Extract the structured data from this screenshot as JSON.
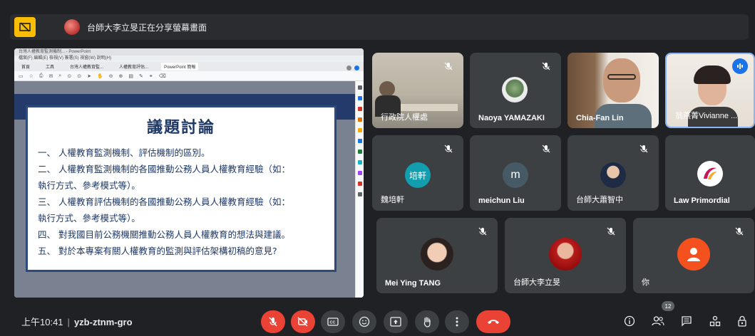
{
  "presenting": {
    "text": "台師大李立旻正在分享螢幕畫面"
  },
  "shared_screen": {
    "app_title": "台灣人權教育監測機制... - PowerPoint",
    "menu": "檔案(F)  編輯(E)  檢視(V)  簽署(S)  視窗(W)  說明(H)",
    "tabs": [
      "首頁",
      "工具",
      "台灣人權教育監...",
      "人權教育評估...",
      "PowerPoint 簡報"
    ],
    "slide": {
      "title": "議題討論",
      "items": [
        "一、 人權教育監測機制、評估機制的區別。",
        "二、 人權教育監測機制的各國推動公務人員人權教育經驗（如：",
        "執行方式、參考模式等）。",
        "三、 人權教育評估機制的各國推動公務人員人權教育經驗（如：",
        "執行方式、參考模式等）。",
        "四、 對我國目前公務機關推動公務人員人權教育的想法與建議。",
        "五、 對於本專案有關人權教育的監測與評估架構初稿的意見?"
      ]
    }
  },
  "participants": [
    {
      "name": "行政院人權處",
      "avatar": ""
    },
    {
      "name": "Naoya YAMAZAKI",
      "avatar": ""
    },
    {
      "name": "Chia-Fan Lin",
      "avatar": ""
    },
    {
      "name": "翁燕菁Vivianne ...",
      "avatar": ""
    },
    {
      "name": "魏培軒",
      "avatar": "培軒"
    },
    {
      "name": "meichun Liu",
      "avatar": "m"
    },
    {
      "name": "台師大蕭智中",
      "avatar": ""
    },
    {
      "name": "Law Primordial",
      "avatar": ""
    },
    {
      "name": "Mei Ying TANG",
      "avatar": ""
    },
    {
      "name": "台師大李立旻",
      "avatar": ""
    },
    {
      "name": "你",
      "avatar": ""
    }
  ],
  "bottom_bar": {
    "time": "上午10:41",
    "meeting_code": "yzb-ztnm-gro",
    "people_count": "12"
  },
  "colors": {
    "mic_off_red": "#ea4335",
    "presenting_yellow": "#fbbc04",
    "speaking_blue": "#1a73e8",
    "background": "#202124",
    "tile": "#3c4043"
  }
}
